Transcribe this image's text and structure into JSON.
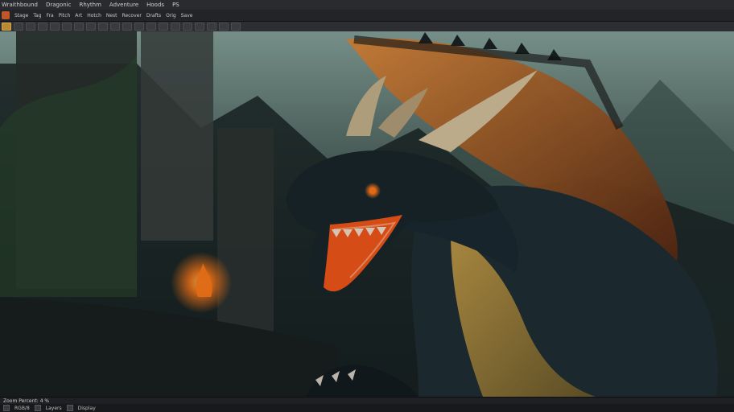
{
  "menubar": {
    "items": [
      "Wraithbound",
      "Dragonic",
      "Rhythm",
      "Adventure",
      "Hoods",
      "PS"
    ]
  },
  "toolbar": {
    "app_logo_icon": "photoshop-logo-icon",
    "items": [
      "Stage",
      "Tag",
      "Fra",
      "Pitch",
      "Art",
      "Hotch",
      "Nest",
      "Recover",
      "Drafts",
      "Orig",
      "Save"
    ]
  },
  "optionsbar": {
    "tool_icons": [
      "move-icon",
      "marquee-icon",
      "lasso-icon",
      "crop-icon",
      "eyedropper-icon",
      "brush-icon",
      "stamp-icon",
      "eraser-icon",
      "gradient-icon",
      "blur-icon",
      "dodge-icon",
      "pen-icon",
      "text-icon",
      "path-icon",
      "shape-icon",
      "hand-icon",
      "zoom-icon",
      "fg-bg-icon",
      "mask-icon",
      "screen-mode-icon"
    ]
  },
  "canvas": {
    "image_label": "Dragon artwork (digital painting)",
    "colors": {
      "eye": "#ff7a1a",
      "fire": "#ff5a1a",
      "scales": "#1f2e35",
      "wing": "#b45b1f"
    }
  },
  "statusbar": {
    "text": "Zoom Percent: 4 %"
  },
  "bottombar": {
    "items": [
      "RGB/8",
      "Layers",
      "Display"
    ]
  }
}
